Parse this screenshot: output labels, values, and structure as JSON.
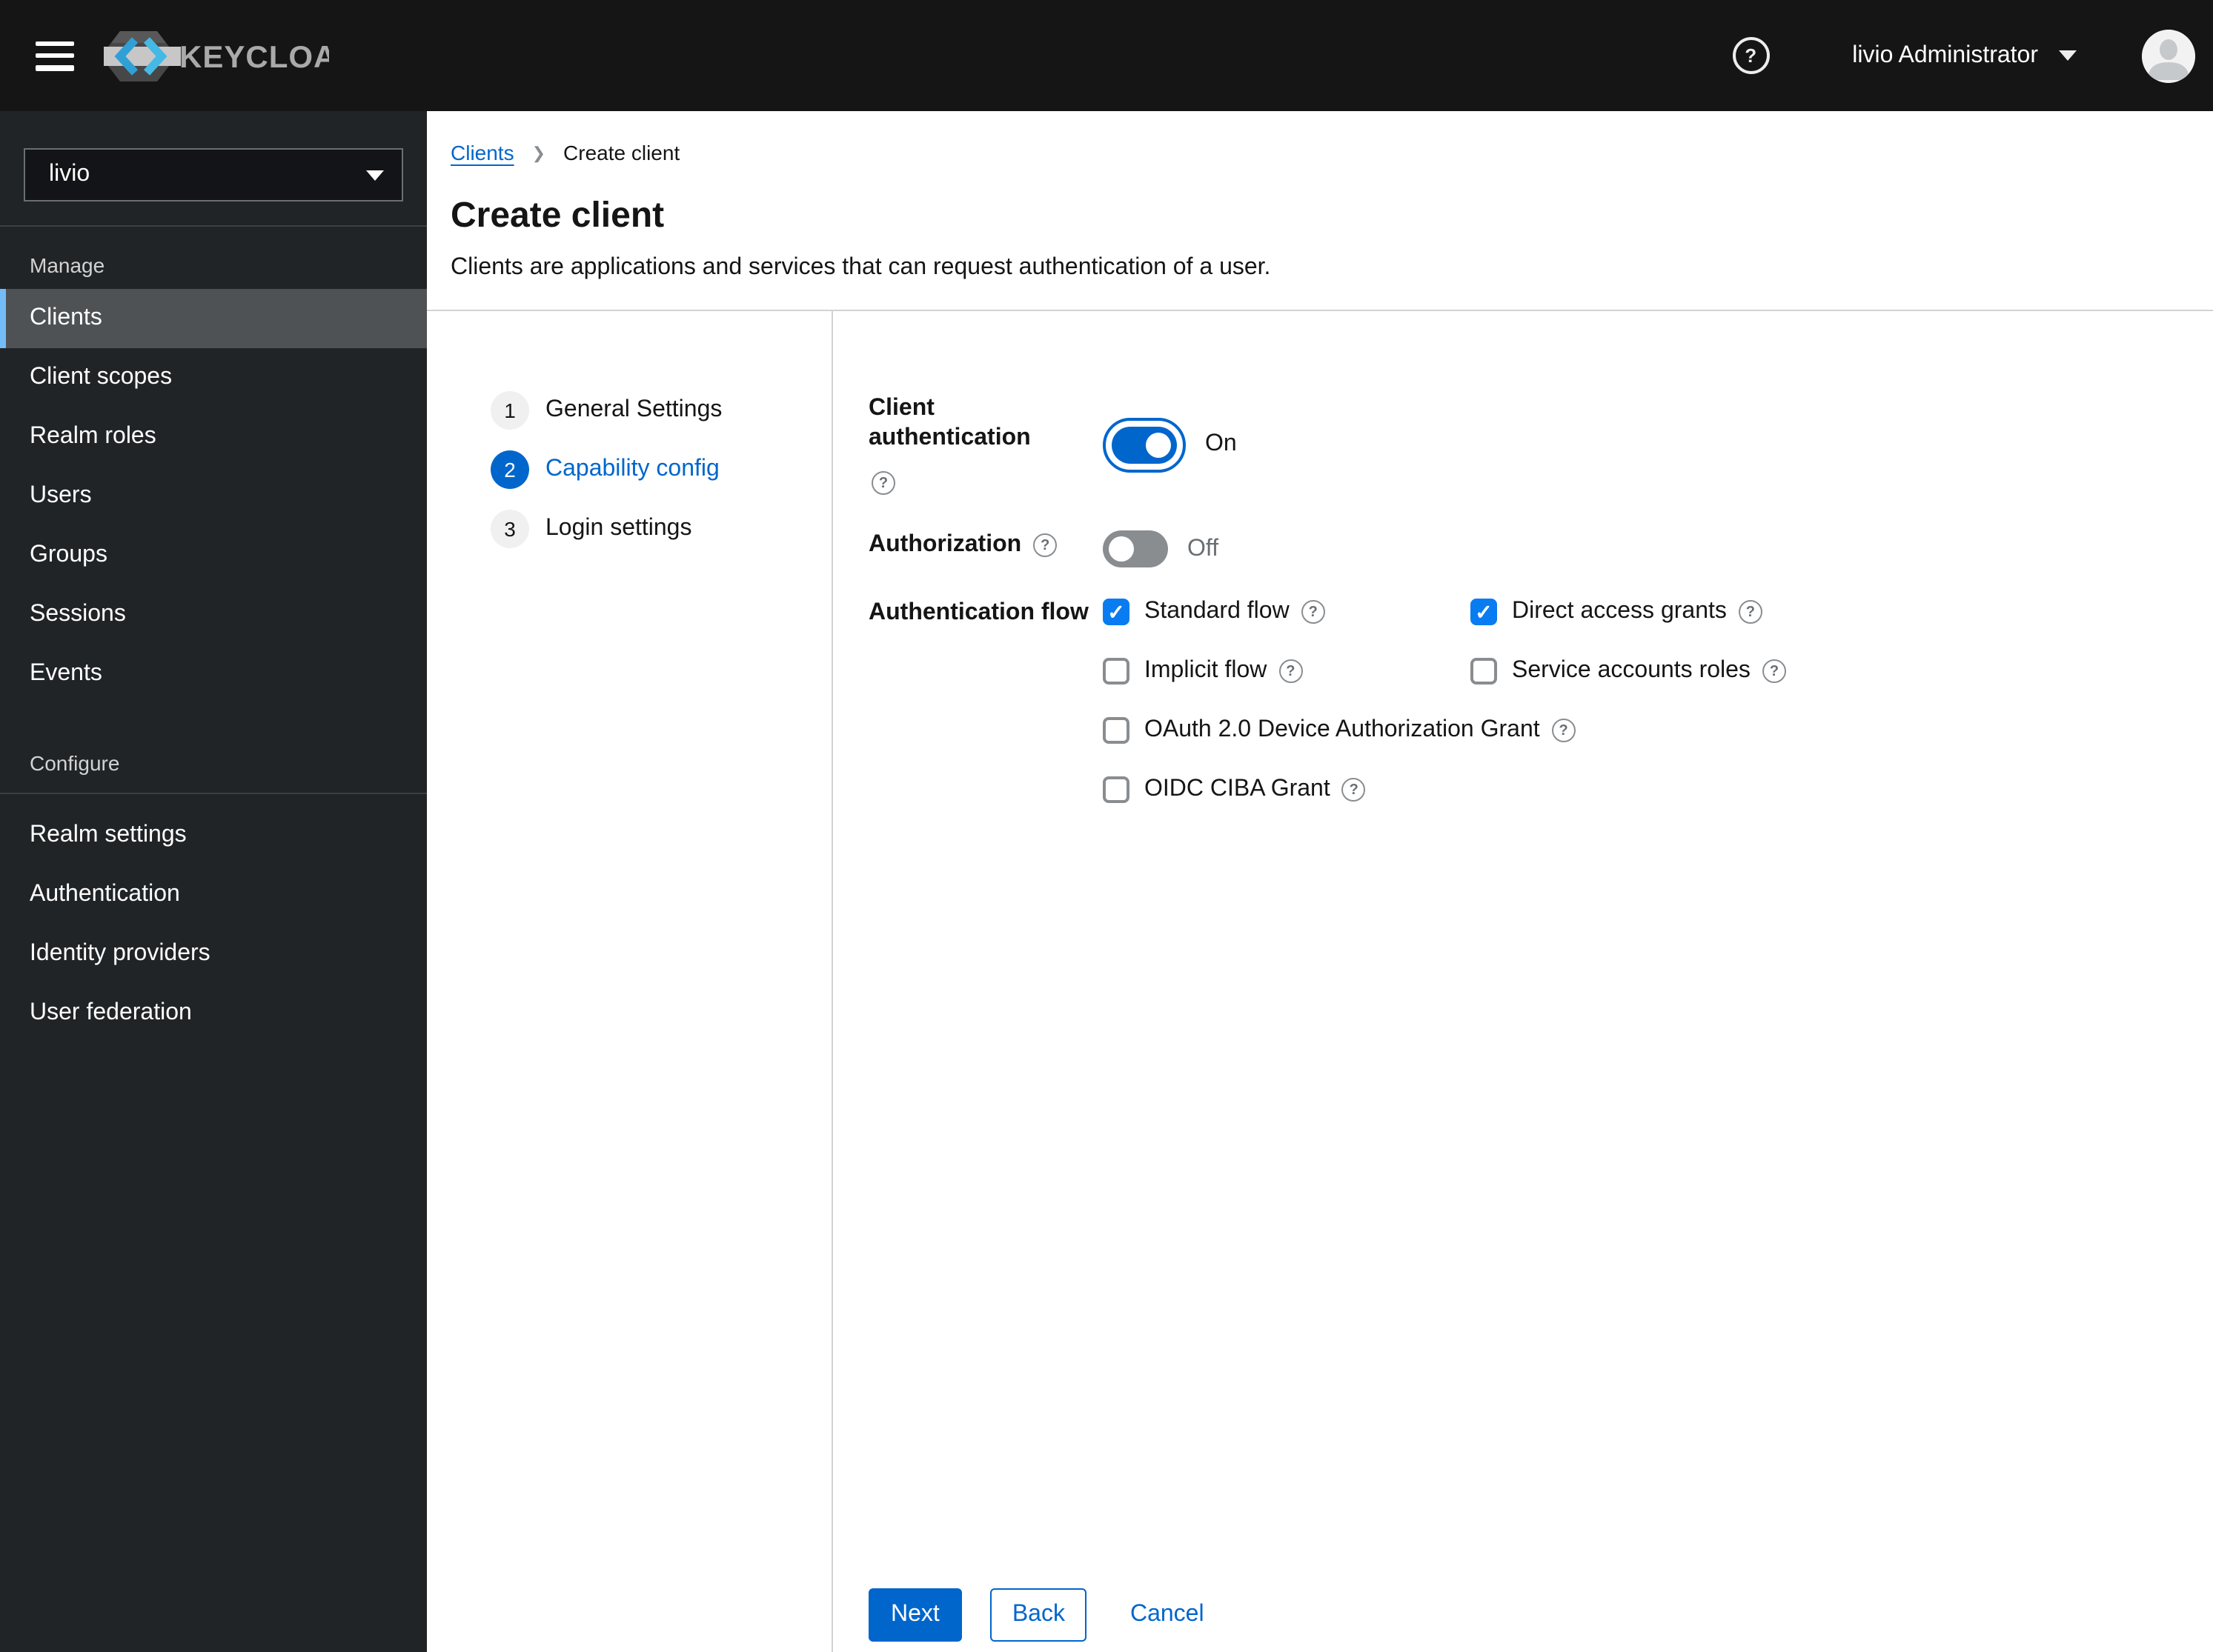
{
  "masthead": {
    "brand": "KEYCLOAK",
    "user_menu": "livio Administrator"
  },
  "sidebar": {
    "realm_selector": {
      "value": "livio"
    },
    "sections": [
      {
        "label": "Manage",
        "items": [
          {
            "label": "Clients",
            "selected": true
          },
          {
            "label": "Client scopes",
            "selected": false
          },
          {
            "label": "Realm roles",
            "selected": false
          },
          {
            "label": "Users",
            "selected": false
          },
          {
            "label": "Groups",
            "selected": false
          },
          {
            "label": "Sessions",
            "selected": false
          },
          {
            "label": "Events",
            "selected": false
          }
        ]
      },
      {
        "label": "Configure",
        "items": [
          {
            "label": "Realm settings",
            "selected": false
          },
          {
            "label": "Authentication",
            "selected": false
          },
          {
            "label": "Identity providers",
            "selected": false
          },
          {
            "label": "User federation",
            "selected": false
          }
        ]
      }
    ]
  },
  "breadcrumb": {
    "items": [
      {
        "label": "Clients",
        "link": true
      },
      {
        "label": "Create client",
        "current": true
      }
    ]
  },
  "page_header": {
    "title": "Create client",
    "description": "Clients are applications and services that can request authentication of a user."
  },
  "wizard": {
    "steps": [
      {
        "number": "1",
        "label": "General Settings",
        "active": false
      },
      {
        "number": "2",
        "label": "Capability config",
        "active": true
      },
      {
        "number": "3",
        "label": "Login settings",
        "active": false
      }
    ]
  },
  "form": {
    "client_authentication": {
      "label": "Client authentication",
      "state": "On",
      "enabled": true
    },
    "authorization": {
      "label": "Authorization",
      "state": "Off",
      "enabled": false
    },
    "authentication_flow": {
      "label": "Authentication flow",
      "options": [
        {
          "label": "Standard flow",
          "checked": true
        },
        {
          "label": "Direct access grants",
          "checked": true
        },
        {
          "label": "Implicit flow",
          "checked": false
        },
        {
          "label": "Service accounts roles",
          "checked": false
        },
        {
          "label": "OAuth 2.0 Device Authorization Grant",
          "checked": false
        },
        {
          "label": "OIDC CIBA Grant",
          "checked": false
        }
      ]
    }
  },
  "actions": {
    "next": "Next",
    "back": "Back",
    "cancel": "Cancel"
  },
  "colors": {
    "primary": "#0066cc",
    "checkbox_checked": "#0a7cf2",
    "sidebar_selected_accent": "#73bcf7",
    "toggle_off": "#8a8d90",
    "masthead_bg": "#151515",
    "sidebar_bg": "#212427"
  }
}
